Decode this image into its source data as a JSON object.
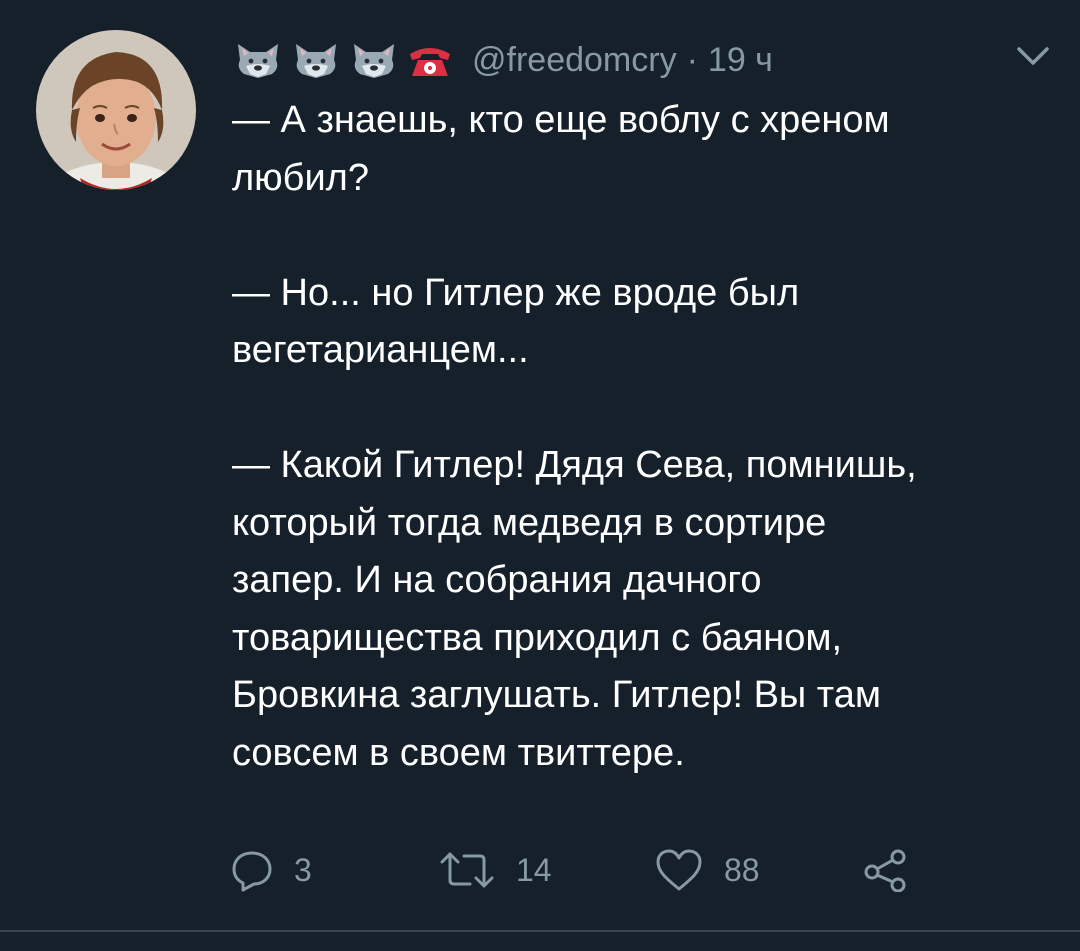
{
  "tweet": {
    "author": {
      "display_emojis": [
        "wolf-face",
        "wolf-face",
        "wolf-face",
        "telephone"
      ],
      "handle": "@freedomcry",
      "separator": "·",
      "time": "19 ч"
    },
    "paragraphs": [
      "— А знаешь, кто еще воблу с хреном\nлюбил?",
      "— Но... но Гитлер же вроде был\nвегетарианцем...",
      "— Какой Гитлер! Дядя Сева, помнишь,\nкоторый тогда медведя в сортире\nзапер. И на собрания дачного\nтоварищества приходил с баяном,\nБровкина заглушать. Гитлер! Вы там\nсовсем в своем твиттере."
    ],
    "actions": {
      "reply": {
        "icon": "reply-icon",
        "count": "3"
      },
      "retweet": {
        "icon": "retweet-icon",
        "count": "14"
      },
      "like": {
        "icon": "heart-icon",
        "count": "88"
      },
      "share": {
        "icon": "share-icon"
      }
    }
  },
  "colors": {
    "background": "#15202b",
    "text": "#ffffff",
    "muted": "#8899a6",
    "divider": "#38444d"
  }
}
